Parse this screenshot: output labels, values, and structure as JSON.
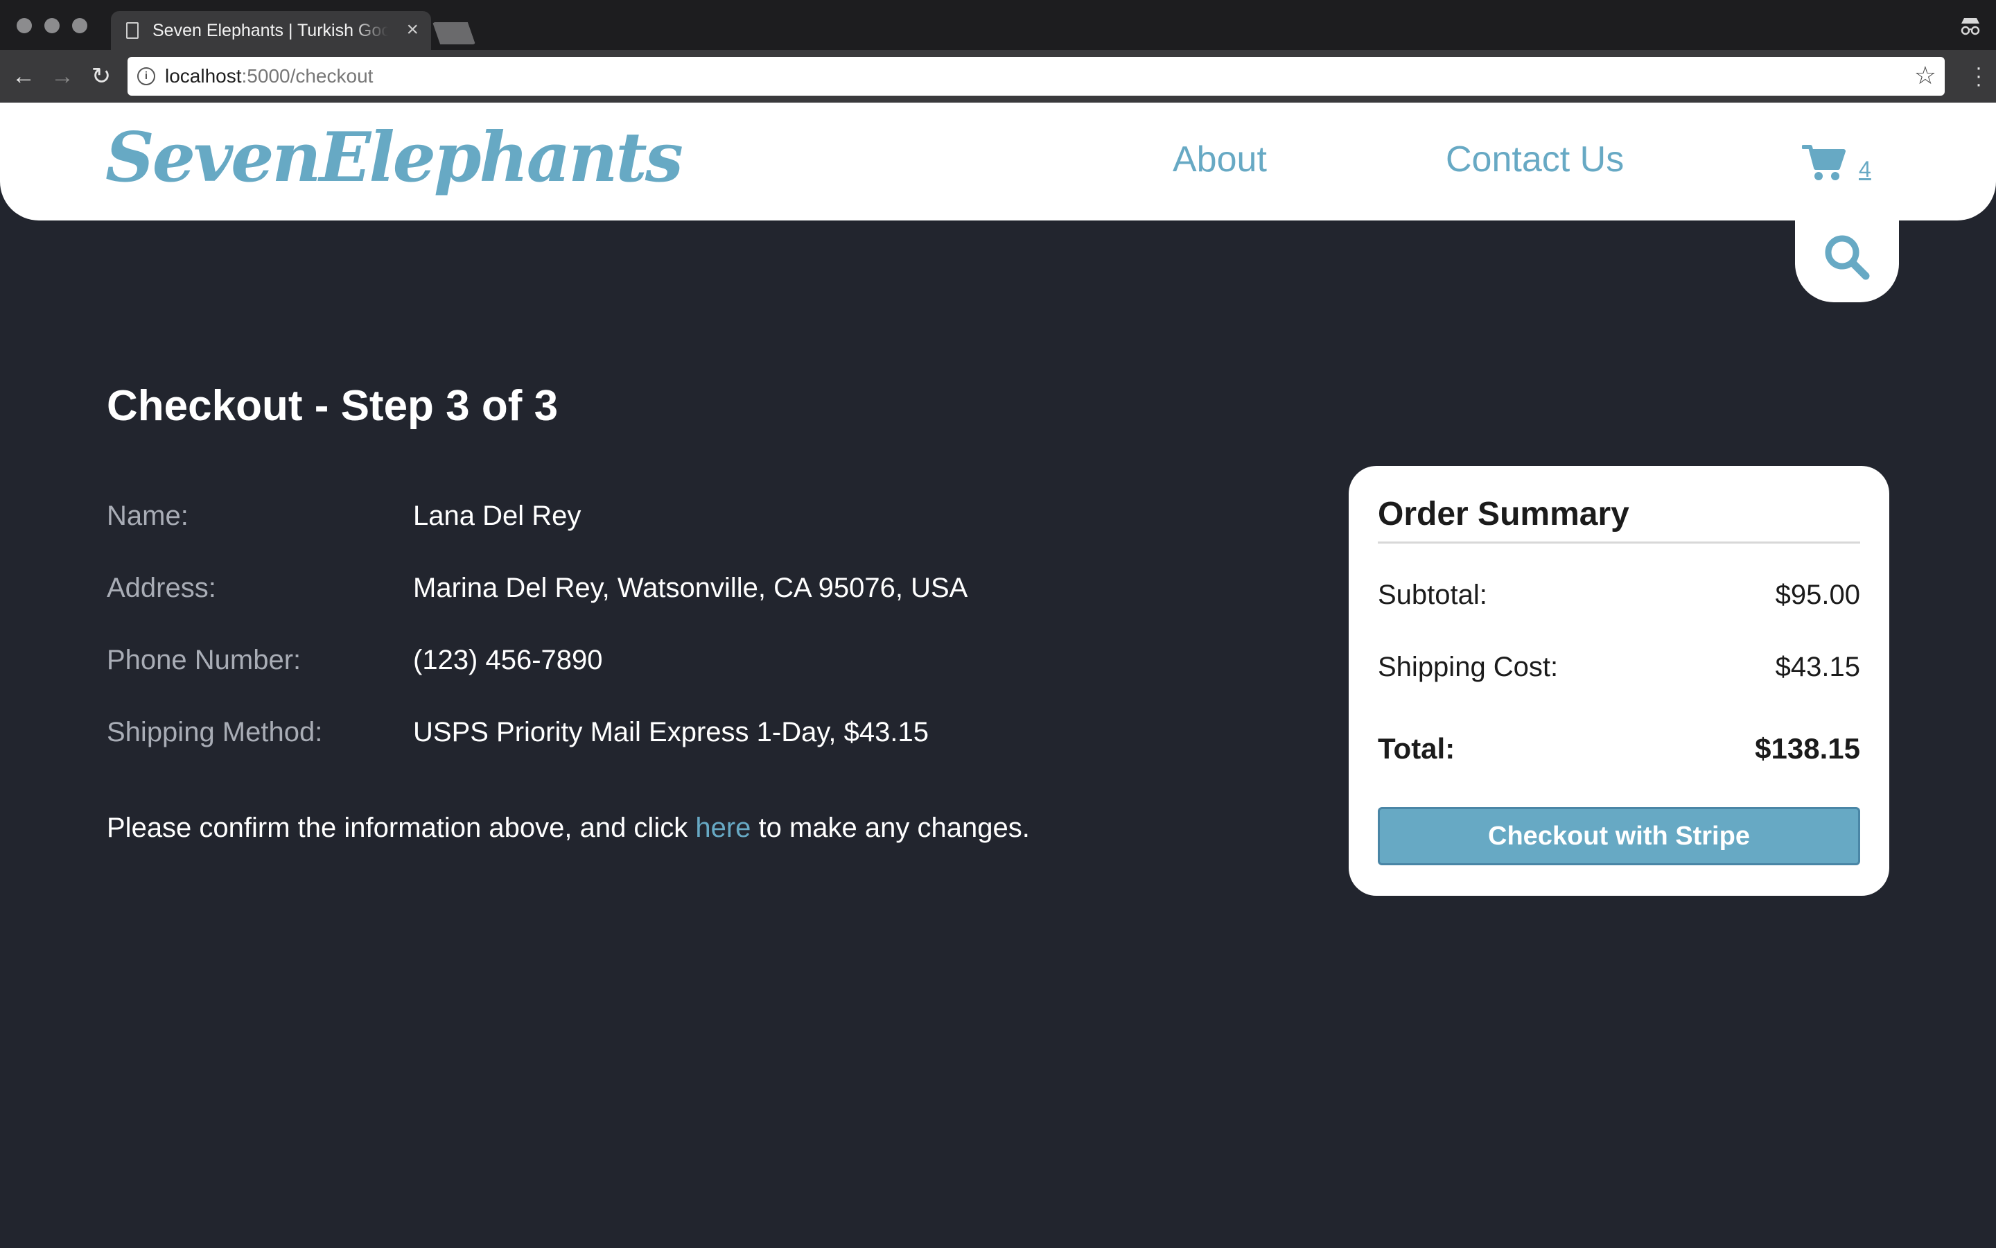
{
  "browser": {
    "tab_title": "Seven Elephants | Turkish Goods",
    "tab_close": "×",
    "url_host": "localhost",
    "url_path": ":5000/checkout"
  },
  "header": {
    "logo": "SevenElephants",
    "nav": [
      "About",
      "Contact Us"
    ],
    "cart_count": "4",
    "accent_color": "#67a9c4"
  },
  "main": {
    "title": "Checkout - Step 3 of 3",
    "details": [
      {
        "label": "Name:",
        "value": "Lana Del Rey"
      },
      {
        "label": "Address:",
        "value": "Marina Del Rey, Watsonville, CA 95076, USA"
      },
      {
        "label": "Phone Number:",
        "value": "(123) 456-7890"
      },
      {
        "label": "Shipping Method:",
        "value": "USPS Priority Mail Express 1-Day, $43.15"
      }
    ],
    "confirm_before": "Please confirm the information above, and click ",
    "confirm_link": "here",
    "confirm_after": " to make any changes."
  },
  "summary": {
    "title": "Order Summary",
    "subtotal_label": "Subtotal:",
    "subtotal_value": "$95.00",
    "shipping_label": "Shipping Cost:",
    "shipping_value": "$43.15",
    "total_label": "Total:",
    "total_value": "$138.15",
    "button_label": "Checkout with Stripe"
  },
  "colors": {
    "background": "#22252e",
    "accent": "#67a9c4"
  }
}
